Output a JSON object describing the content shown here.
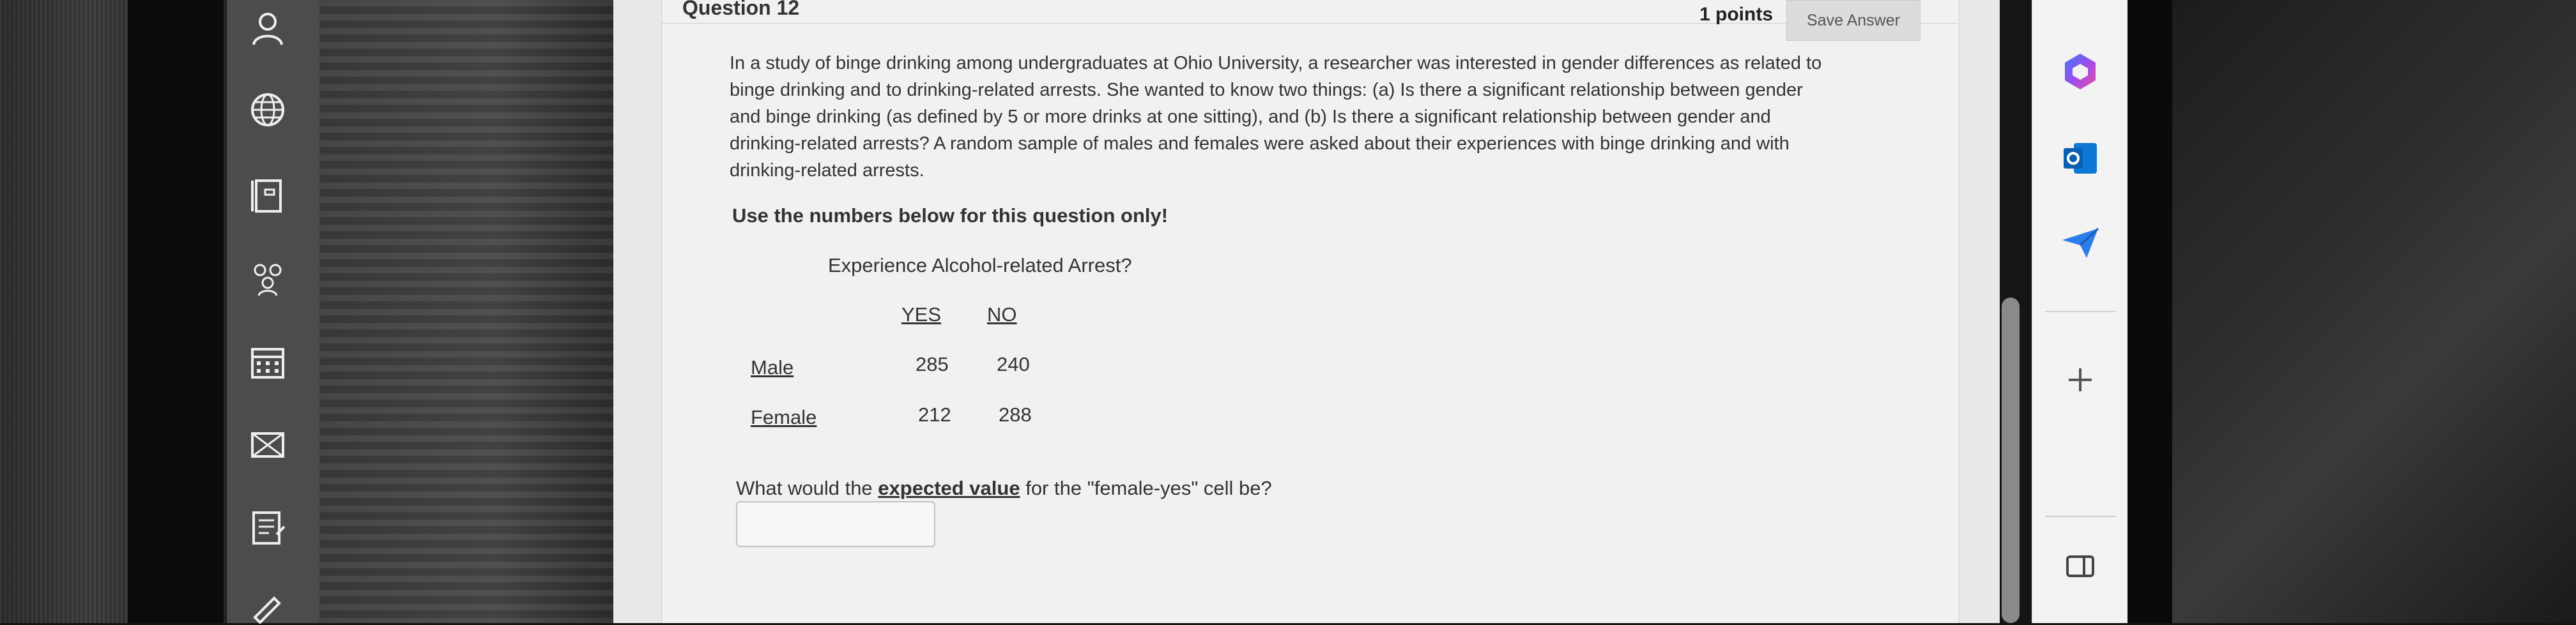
{
  "question": {
    "title": "Question 12",
    "points": "1 points",
    "save_label": "Save Answer",
    "paragraph_lines": [
      "In a study of binge drinking among undergraduates at Ohio University, a researcher was interested in gender differences as related to",
      "binge drinking and to drinking-related arrests. She wanted to know two things: (a) Is there a significant relationship between gender",
      "and binge drinking (as defined by 5 or more drinks at one sitting), and (b) Is there a significant relationship between gender and",
      "drinking-related arrests? A random sample of males and females were asked about their experiences with binge drinking and with",
      "drinking-related arrests."
    ],
    "instruction": "Use the numbers below for this question only!",
    "table": {
      "title": "Experience Alcohol-related Arrest?",
      "columns": [
        "YES",
        "NO"
      ],
      "rows": [
        {
          "label": "Male",
          "values": [
            "285",
            "240"
          ]
        },
        {
          "label": "Female",
          "values": [
            "212",
            "288"
          ]
        }
      ]
    },
    "prompt_prefix": "What would the ",
    "prompt_emphasis": "expected value",
    "prompt_suffix": " for the \"female-yes\" cell be?",
    "answer_value": ""
  },
  "left_rail": {
    "icons": [
      "user-icon",
      "globe-icon",
      "book-icon",
      "groups-icon",
      "calendar-icon",
      "mail-icon",
      "notes-icon",
      "pen-icon"
    ]
  },
  "right_rail": {
    "icons": [
      "copilot-icon",
      "outlook-icon",
      "send-icon",
      "plus-icon",
      "sidebar-toggle-icon"
    ]
  }
}
